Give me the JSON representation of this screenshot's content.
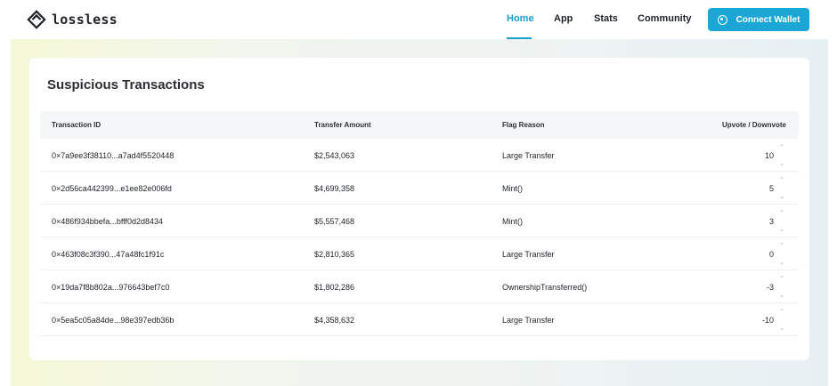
{
  "brand": {
    "name": "lossless"
  },
  "nav": {
    "items": [
      {
        "label": "Home",
        "active": true
      },
      {
        "label": "App"
      },
      {
        "label": "Stats"
      },
      {
        "label": "Community"
      }
    ],
    "connect_label": "Connect Wallet"
  },
  "colors": {
    "accent": "#1ba6d6",
    "nav_active": "#1a9ecf"
  },
  "page": {
    "title": "Suspicious Transactions"
  },
  "table": {
    "headers": [
      "Transaction ID",
      "Transfer Amount",
      "Flag Reason",
      "Upvote / Downvote"
    ],
    "rows": [
      {
        "id": "0×7a9ee3f38110...a7ad4f5520448",
        "amount": "$2,543,063",
        "reason": "Large Transfer",
        "votes": "10"
      },
      {
        "id": "0×2d56ca442399...e1ee82e006fd",
        "amount": "$4,699,358",
        "reason": "Mint()",
        "votes": "5"
      },
      {
        "id": "0×486f934bbefa...bfff0d2d8434",
        "amount": "$5,557,468",
        "reason": "Mint()",
        "votes": "3"
      },
      {
        "id": "0×463f08c3f390...47a48fc1f91c",
        "amount": "$2,810,365",
        "reason": "Large Transfer",
        "votes": "0"
      },
      {
        "id": "0×19da7f8b802a...976643bef7c0",
        "amount": "$1,802,286",
        "reason": "OwnershipTransferred()",
        "votes": "-3"
      },
      {
        "id": "0×5ea5c05a84de...98e397edb36b",
        "amount": "$4,358,632",
        "reason": "Large Transfer",
        "votes": "-10"
      }
    ],
    "vote_icons": {
      "up": "chevron-up-icon",
      "down": "chevron-down-icon"
    }
  }
}
